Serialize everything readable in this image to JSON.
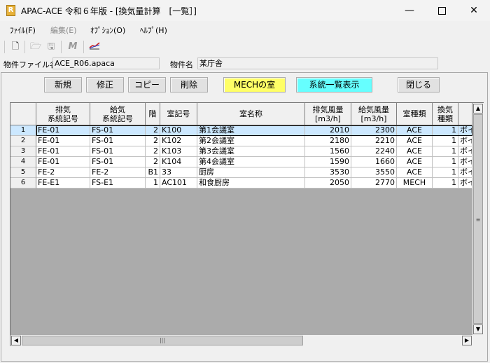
{
  "window": {
    "title": "APAC-ACE 令和６年版 - [換気量計算　[一覧］]",
    "controls": [
      "minimize",
      "maximize",
      "close"
    ]
  },
  "menu": [
    "ﾌｧｲﾙ(F)",
    "編集(E)",
    "ｵﾌﾟｼｮﾝ(O)",
    "ﾍﾙﾌﾟ(H)"
  ],
  "toolbar_icons": [
    "new-file-icon",
    "open-folder-icon",
    "save-icon",
    "m-icon",
    "chart-icon"
  ],
  "file_info": {
    "file_label": "物件ファイル名",
    "file_value": "ACE_R06.apaca",
    "name_label": "物件名",
    "name_value": "某庁舎"
  },
  "buttons": {
    "new": "新規",
    "edit": "修正",
    "copy": "コピー",
    "delete": "削除",
    "mech": "MECHの室",
    "system_list": "系統一覧表示",
    "close": "閉じる"
  },
  "accent_colors": {
    "mech_button": "#ffff66",
    "system_button": "#66ffff",
    "selected_row": "#cce8ff"
  },
  "table": {
    "headers": [
      "排気\n系統記号",
      "給気\n系統記号",
      "階",
      "室記号",
      "室名称",
      "排気風量\n[m3/h]",
      "給気風量\n[m3/h]",
      "室種類",
      "換気\n種類"
    ],
    "selected_row": 1,
    "rows": [
      {
        "no": "1",
        "cells": [
          "FE-01",
          "FS-01",
          "2",
          "K100",
          "第1会議室",
          "2010",
          "2300",
          "ACE",
          "1",
          "ボイ"
        ]
      },
      {
        "no": "2",
        "cells": [
          "FE-01",
          "FS-01",
          "2",
          "K102",
          "第2会議室",
          "2180",
          "2210",
          "ACE",
          "1",
          "ボイ"
        ]
      },
      {
        "no": "3",
        "cells": [
          "FE-01",
          "FS-01",
          "2",
          "K103",
          "第3会議室",
          "1560",
          "2240",
          "ACE",
          "1",
          "ボイ"
        ]
      },
      {
        "no": "4",
        "cells": [
          "FE-01",
          "FS-01",
          "2",
          "K104",
          "第4会議室",
          "1590",
          "1660",
          "ACE",
          "1",
          "ボイ"
        ]
      },
      {
        "no": "5",
        "cells": [
          "FE-2",
          "FE-2",
          "B1",
          "33",
          "厨房",
          "3530",
          "3550",
          "ACE",
          "1",
          "ボイ"
        ]
      },
      {
        "no": "6",
        "cells": [
          "FE-E1",
          "FS-E1",
          "1",
          "AC101",
          "和食厨房",
          "2050",
          "2770",
          "MECH",
          "1",
          "ボイ"
        ]
      }
    ]
  }
}
